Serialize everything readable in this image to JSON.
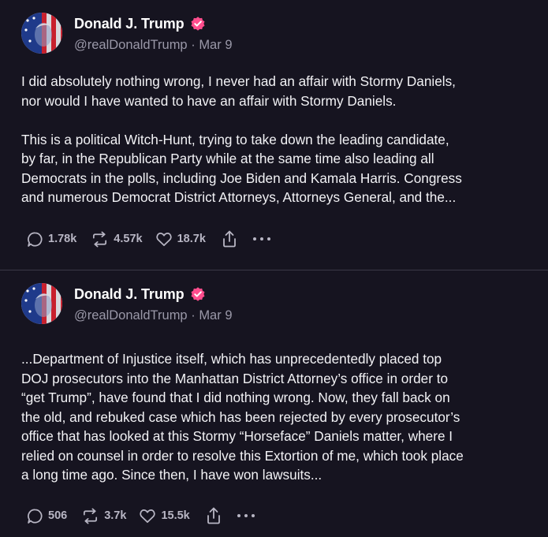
{
  "posts": [
    {
      "display_name": "Donald J. Trump",
      "handle": "@realDonaldTrump",
      "separator": "·",
      "date": "Mar 9",
      "paragraphs": [
        [
          "I did absolutely nothing wrong, I never had an affair with Stormy Daniels,",
          "nor would I have wanted to have an affair with Stormy Daniels."
        ],
        [
          "This is a political Witch-Hunt, trying to take down the leading candidate,",
          "by far, in the Republican Party while at the same time also leading all",
          "Democrats in the polls, including Joe Biden and Kamala Harris. Congress",
          "and numerous Democrat District Attorneys, Attorneys General, and the..."
        ]
      ],
      "stats": {
        "replies": "1.78k",
        "reposts": "4.57k",
        "likes": "18.7k"
      }
    },
    {
      "display_name": "Donald J. Trump",
      "handle": "@realDonaldTrump",
      "separator": "·",
      "date": "Mar 9",
      "paragraphs": [
        [
          "...Department of Injustice itself, which has unprecedentedly placed top",
          "DOJ prosecutors into the Manhattan District Attorney’s office in order to",
          "“get Trump”, have found that I did nothing wrong. Now, they fall back on",
          "the old, and rebuked case which has been rejected by every prosecutor’s",
          "office that has looked at this Stormy “Horseface” Daniels matter, where I",
          "relied on counsel in order to resolve this Extortion of me, which took place",
          "a long time ago. Since then, I have won lawsuits..."
        ]
      ],
      "stats": {
        "replies": "506",
        "reposts": "3.7k",
        "likes": "15.5k"
      }
    }
  ],
  "icons": {
    "verified": "verified-badge-icon",
    "reply": "reply-icon",
    "repost": "repost-icon",
    "like": "like-icon",
    "share": "share-icon",
    "more": "more-icon"
  },
  "colors": {
    "background": "#161420",
    "verified_badge": "#ff4d8d",
    "muted_text": "#9a98a8",
    "action_text": "#b8b6c4",
    "divider": "#3a3847"
  }
}
